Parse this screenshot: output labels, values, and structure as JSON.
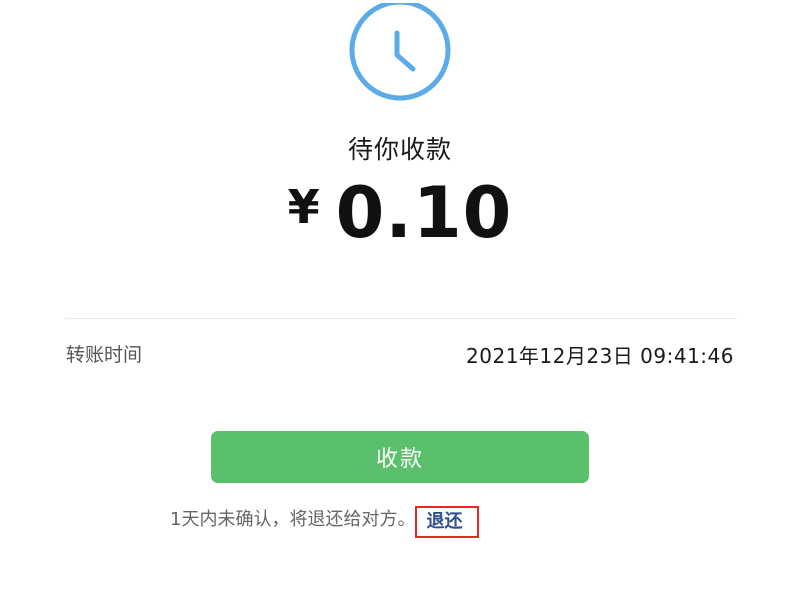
{
  "status": {
    "icon": "clock-icon",
    "title": "待你收款"
  },
  "amount": {
    "currency_symbol": "¥",
    "value": "0.10"
  },
  "details": {
    "transfer_time_label": "转账时间",
    "transfer_time_value": "2021年12月23日 09:41:46"
  },
  "actions": {
    "receive_button_label": "收款"
  },
  "notice": {
    "text": "1天内未确认，将退还给对方。",
    "return_link_label": "退还"
  },
  "colors": {
    "clock_icon": "#5aabe8",
    "button_green": "#5ac06b",
    "link_blue": "#2f4f8f",
    "highlight_box_red": "#e12a22"
  }
}
